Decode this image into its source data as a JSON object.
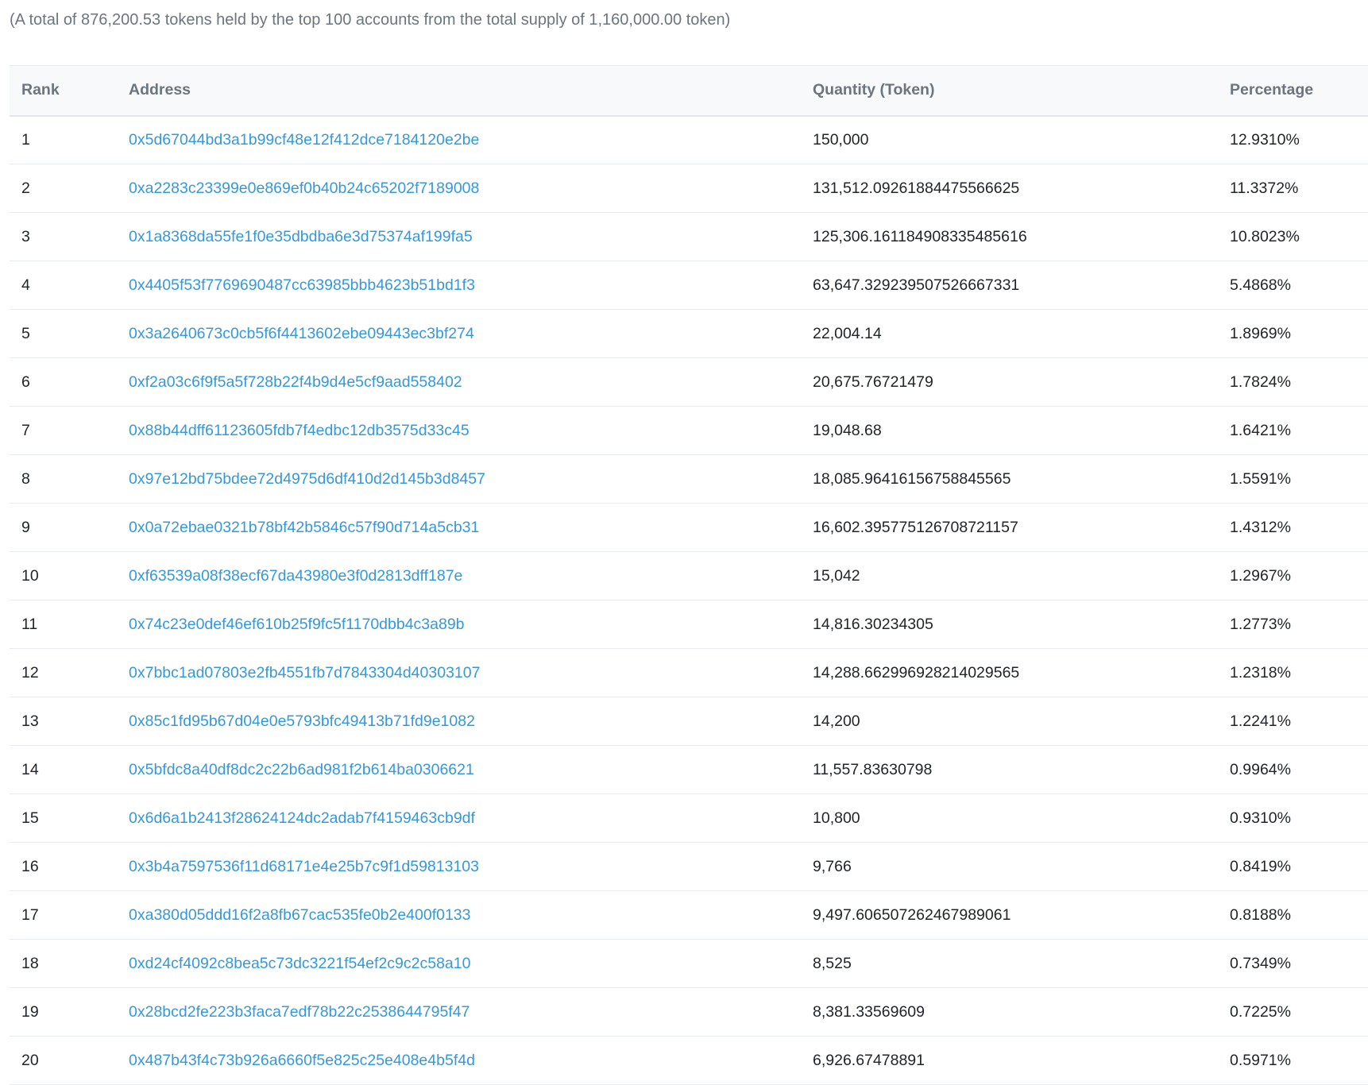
{
  "summary": "(A total of 876,200.53 tokens held by the top 100 accounts from the total supply of 1,160,000.00 token)",
  "colors": {
    "link": "#3498db",
    "header_bg": "#f8f9fa",
    "muted_text": "#6c757d",
    "row_border": "#e7eaf3"
  },
  "table": {
    "headers": {
      "rank": "Rank",
      "address": "Address",
      "quantity": "Quantity (Token)",
      "percentage": "Percentage"
    },
    "rows": [
      {
        "rank": "1",
        "address": "0x5d67044bd3a1b99cf48e12f412dce7184120e2be",
        "quantity": "150,000",
        "percentage": "12.9310%"
      },
      {
        "rank": "2",
        "address": "0xa2283c23399e0e869ef0b40b24c65202f7189008",
        "quantity": "131,512.09261884475566625",
        "percentage": "11.3372%"
      },
      {
        "rank": "3",
        "address": "0x1a8368da55fe1f0e35dbdba6e3d75374af199fa5",
        "quantity": "125,306.161184908335485616",
        "percentage": "10.8023%"
      },
      {
        "rank": "4",
        "address": "0x4405f53f7769690487cc63985bbb4623b51bd1f3",
        "quantity": "63,647.329239507526667331",
        "percentage": "5.4868%"
      },
      {
        "rank": "5",
        "address": "0x3a2640673c0cb5f6f4413602ebe09443ec3bf274",
        "quantity": "22,004.14",
        "percentage": "1.8969%"
      },
      {
        "rank": "6",
        "address": "0xf2a03c6f9f5a5f728b22f4b9d4e5cf9aad558402",
        "quantity": "20,675.76721479",
        "percentage": "1.7824%"
      },
      {
        "rank": "7",
        "address": "0x88b44dff61123605fdb7f4edbc12db3575d33c45",
        "quantity": "19,048.68",
        "percentage": "1.6421%"
      },
      {
        "rank": "8",
        "address": "0x97e12bd75bdee72d4975d6df410d2d145b3d8457",
        "quantity": "18,085.96416156758845565",
        "percentage": "1.5591%"
      },
      {
        "rank": "9",
        "address": "0x0a72ebae0321b78bf42b5846c57f90d714a5cb31",
        "quantity": "16,602.395775126708721157",
        "percentage": "1.4312%"
      },
      {
        "rank": "10",
        "address": "0xf63539a08f38ecf67da43980e3f0d2813dff187e",
        "quantity": "15,042",
        "percentage": "1.2967%"
      },
      {
        "rank": "11",
        "address": "0x74c23e0def46ef610b25f9fc5f1170dbb4c3a89b",
        "quantity": "14,816.30234305",
        "percentage": "1.2773%"
      },
      {
        "rank": "12",
        "address": "0x7bbc1ad07803e2fb4551fb7d7843304d40303107",
        "quantity": "14,288.662996928214029565",
        "percentage": "1.2318%"
      },
      {
        "rank": "13",
        "address": "0x85c1fd95b67d04e0e5793bfc49413b71fd9e1082",
        "quantity": "14,200",
        "percentage": "1.2241%"
      },
      {
        "rank": "14",
        "address": "0x5bfdc8a40df8dc2c22b6ad981f2b614ba0306621",
        "quantity": "11,557.83630798",
        "percentage": "0.9964%"
      },
      {
        "rank": "15",
        "address": "0x6d6a1b2413f28624124dc2adab7f4159463cb9df",
        "quantity": "10,800",
        "percentage": "0.9310%"
      },
      {
        "rank": "16",
        "address": "0x3b4a7597536f11d68171e4e25b7c9f1d59813103",
        "quantity": "9,766",
        "percentage": "0.8419%"
      },
      {
        "rank": "17",
        "address": "0xa380d05ddd16f2a8fb67cac535fe0b2e400f0133",
        "quantity": "9,497.606507262467989061",
        "percentage": "0.8188%"
      },
      {
        "rank": "18",
        "address": "0xd24cf4092c8bea5c73dc3221f54ef2c9c2c58a10",
        "quantity": "8,525",
        "percentage": "0.7349%"
      },
      {
        "rank": "19",
        "address": "0x28bcd2fe223b3faca7edf78b22c2538644795f47",
        "quantity": "8,381.33569609",
        "percentage": "0.7225%"
      },
      {
        "rank": "20",
        "address": "0x487b43f4c73b926a6660f5e825c25e408e4b5f4d",
        "quantity": "6,926.67478891",
        "percentage": "0.5971%"
      }
    ]
  }
}
